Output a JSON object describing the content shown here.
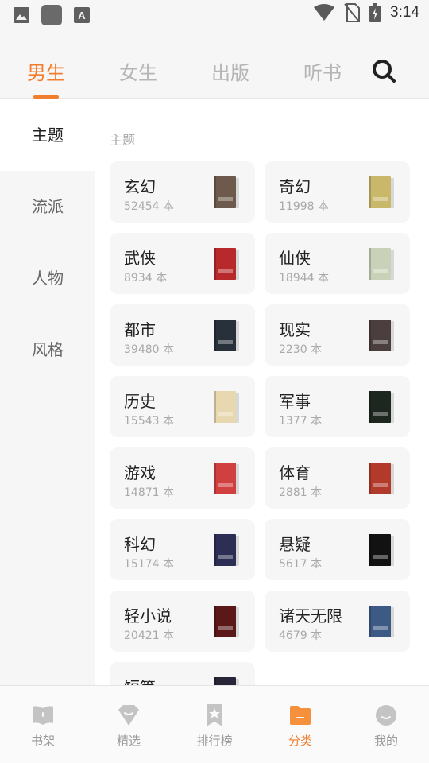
{
  "status_bar": {
    "time": "3:14",
    "left_icons": [
      "image-icon",
      "app-icon",
      "keyboard-icon"
    ],
    "right_icons": [
      "wifi-icon",
      "no-sim-icon",
      "battery-icon"
    ]
  },
  "top_tabs": [
    {
      "label": "男生",
      "active": true
    },
    {
      "label": "女生",
      "active": false
    },
    {
      "label": "出版",
      "active": false
    },
    {
      "label": "听书",
      "active": false
    }
  ],
  "side_nav": [
    {
      "label": "主题",
      "active": true
    },
    {
      "label": "流派",
      "active": false
    },
    {
      "label": "人物",
      "active": false
    },
    {
      "label": "风格",
      "active": false
    }
  ],
  "section_title": "主题",
  "categories": [
    {
      "name": "玄幻",
      "count": "52454 本",
      "cover_color": "#6e5a4c"
    },
    {
      "name": "奇幻",
      "count": "11998 本",
      "cover_color": "#c9b86a"
    },
    {
      "name": "武侠",
      "count": "8934 本",
      "cover_color": "#b8292c"
    },
    {
      "name": "仙侠",
      "count": "18944 本",
      "cover_color": "#c9d2b8"
    },
    {
      "name": "都市",
      "count": "39480 本",
      "cover_color": "#28303a"
    },
    {
      "name": "现实",
      "count": "2230 本",
      "cover_color": "#4a3e3e"
    },
    {
      "name": "历史",
      "count": "15543 本",
      "cover_color": "#e8d8b0"
    },
    {
      "name": "军事",
      "count": "1377 本",
      "cover_color": "#1e2620"
    },
    {
      "name": "游戏",
      "count": "14871 本",
      "cover_color": "#d04040"
    },
    {
      "name": "体育",
      "count": "2881 本",
      "cover_color": "#b23a2a"
    },
    {
      "name": "科幻",
      "count": "15174 本",
      "cover_color": "#2c2e54"
    },
    {
      "name": "悬疑",
      "count": "5617 本",
      "cover_color": "#121212"
    },
    {
      "name": "轻小说",
      "count": "20421 本",
      "cover_color": "#5a1818"
    },
    {
      "name": "诸天无限",
      "count": "4679 本",
      "cover_color": "#3c5a84"
    },
    {
      "name": "短篇",
      "count": "",
      "cover_color": "#2a2438"
    }
  ],
  "bottom_nav": [
    {
      "label": "书架",
      "icon": "bookshelf-icon",
      "active": false
    },
    {
      "label": "精选",
      "icon": "featured-icon",
      "active": false
    },
    {
      "label": "排行榜",
      "icon": "ranking-icon",
      "active": false
    },
    {
      "label": "分类",
      "icon": "folder-icon",
      "active": true
    },
    {
      "label": "我的",
      "icon": "profile-icon",
      "active": false
    }
  ],
  "colors": {
    "accent": "#f27d2e",
    "inactive": "#b5b5b5",
    "background": "#f6f6f6",
    "panel": "#ffffff"
  }
}
